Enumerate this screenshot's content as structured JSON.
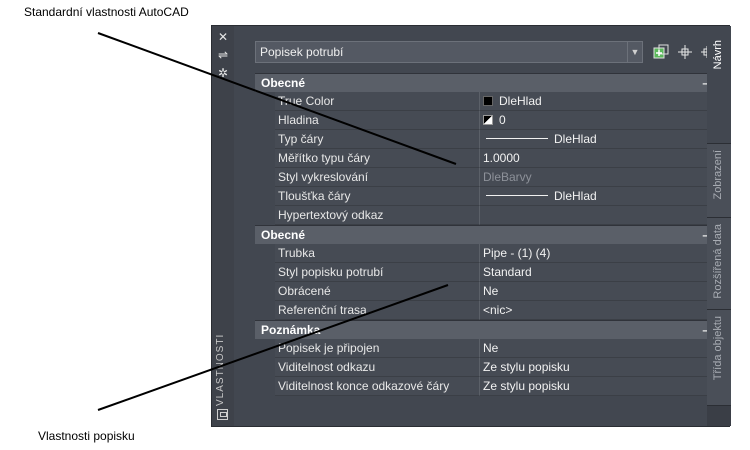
{
  "callouts": {
    "top": "Standardní vlastnosti AutoCAD",
    "bottom": "Vlastnosti popisku"
  },
  "palette": {
    "strip_title": "VLASTNOSTI",
    "selector": "Popisek potrubí",
    "sections": [
      {
        "title": "Obecné",
        "rows": [
          {
            "name": "True Color",
            "value": "DleHlad",
            "kind": "color"
          },
          {
            "name": "Hladina",
            "value": "0",
            "kind": "layer"
          },
          {
            "name": "Typ čáry",
            "value": "DleHlad",
            "kind": "line"
          },
          {
            "name": "Měřítko typu čáry",
            "value": "1.0000",
            "kind": "text"
          },
          {
            "name": "Styl vykreslování",
            "value": "DleBarvy",
            "kind": "dim"
          },
          {
            "name": "Tloušťka čáry",
            "value": "DleHlad",
            "kind": "line"
          },
          {
            "name": "Hypertextový odkaz",
            "value": "",
            "kind": "text"
          }
        ]
      },
      {
        "title": "Obecné",
        "rows": [
          {
            "name": "Trubka",
            "value": "Pipe - (1) (4)",
            "kind": "text"
          },
          {
            "name": "Styl popisku potrubí",
            "value": "Standard",
            "kind": "text"
          },
          {
            "name": "Obrácené",
            "value": "Ne",
            "kind": "text"
          },
          {
            "name": "Referenční trasa",
            "value": "<nic>",
            "kind": "text"
          }
        ]
      },
      {
        "title": "Poznámka",
        "rows": [
          {
            "name": "Popisek je připojen",
            "value": "Ne",
            "kind": "text"
          },
          {
            "name": "Viditelnost odkazu",
            "value": "Ze stylu popisku",
            "kind": "text"
          },
          {
            "name": "Viditelnost konce odkazové čáry",
            "value": "Ze stylu popisku",
            "kind": "text"
          }
        ]
      }
    ],
    "collapse_symbol": "–",
    "tabs": [
      "Návrh",
      "Zobrazení",
      "Rozšířená data",
      "Třída objektu"
    ]
  }
}
